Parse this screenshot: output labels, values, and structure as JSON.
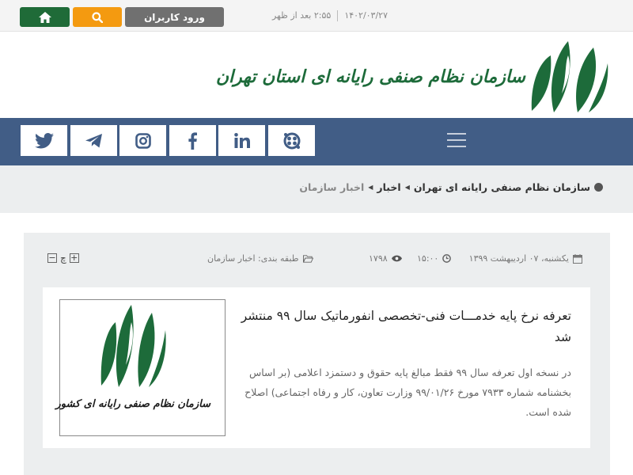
{
  "topbar": {
    "login_label": "ورود کاربران",
    "date": "۱۴۰۲/۰۳/۲۷",
    "time": "۲:۵۵ بعد از ظهر",
    "icons": {
      "home": "home-icon",
      "search": "search-icon"
    },
    "colors": {
      "home": "#1f6b38",
      "search": "#f49a10",
      "login": "#707070"
    }
  },
  "header": {
    "org_name": "سازمان نظام صنفی رایانه ای استان تهران",
    "brand_color": "#1d6b3a"
  },
  "nav": {
    "bg_color": "#415d86",
    "social": [
      "aparat-icon",
      "linkedin-icon",
      "facebook-icon",
      "instagram-icon",
      "telegram-icon",
      "twitter-icon"
    ]
  },
  "breadcrumb": {
    "items": [
      "سازمان نظام صنفی رایانه ای تهران",
      "اخبار",
      "اخبار سازمان"
    ]
  },
  "article_meta": {
    "date": "یکشنبه، ۰۷ اردیبهشت ۱۳۹۹",
    "time": "۱۵:۰۰",
    "views": "۱۷۹۸",
    "category": "طبقه بندی: اخبار سازمان",
    "print_label": "چ"
  },
  "article": {
    "title": "تعرفه نرخ پایه خدمـــات فنی-تخصصی انفورماتیک سال ۹۹ منتشر شد",
    "excerpt": "در نسخه اول تعرفه سال ۹۹ فقط مبالغ پایه حقوق و دستمزد اعلامی (بر اساس بخشنامه شماره ۷۹۳۳ مورخ ۹۹/۰۱/۲۶ وزارت تعاون، کار و رفاه اجتماعی) اصلاح شده است.",
    "thumbnail_caption": "سازمان نظام صنفی رایانه ای کشور"
  }
}
